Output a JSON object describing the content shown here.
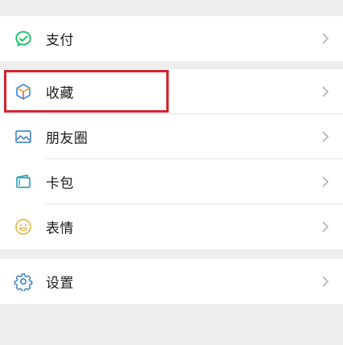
{
  "colors": {
    "background": "#ededed",
    "card": "#ffffff",
    "text": "#191919",
    "chevron": "#b2b2b2",
    "highlight": "#d6222a",
    "pay_green": "#07c160",
    "favorites_blue": "#3d8fe8",
    "moments_blue": "#4a89cc",
    "cards_teal": "#3aa2b7",
    "stickers_yellow": "#e6b54a",
    "settings_blue": "#3b82c4"
  },
  "sections": [
    {
      "items": [
        {
          "label": "支付",
          "icon": "pay-check-icon"
        }
      ]
    },
    {
      "items": [
        {
          "label": "收藏",
          "icon": "favorites-cube-icon"
        },
        {
          "label": "朋友圈",
          "icon": "moments-picture-icon"
        },
        {
          "label": "卡包",
          "icon": "card-wallet-icon"
        },
        {
          "label": "表情",
          "icon": "smiley-face-icon"
        }
      ]
    },
    {
      "items": [
        {
          "label": "设置",
          "icon": "gear-icon"
        }
      ]
    }
  ],
  "highlighted_item": "收藏"
}
